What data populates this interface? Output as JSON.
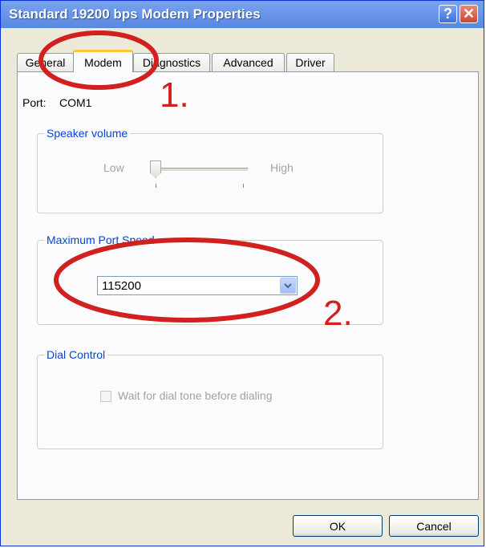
{
  "window": {
    "title": "Standard 19200 bps Modem Properties",
    "help_label": "?",
    "close_label": "✕"
  },
  "tabs": [
    {
      "label": "General",
      "active": false
    },
    {
      "label": "Modem",
      "active": true
    },
    {
      "label": "Diagnostics",
      "active": false
    },
    {
      "label": "Advanced",
      "active": false
    },
    {
      "label": "Driver",
      "active": false
    }
  ],
  "port": {
    "label": "Port:",
    "value": "COM1"
  },
  "speaker": {
    "group_title": "Speaker volume",
    "low_label": "Low",
    "high_label": "High",
    "level": 0
  },
  "max_speed": {
    "group_title": "Maximum Port Speed",
    "selected_value": "115200"
  },
  "dial_control": {
    "group_title": "Dial Control",
    "checkbox_label": "Wait for dial tone before dialing",
    "checked": false
  },
  "footer": {
    "ok_label": "OK",
    "cancel_label": "Cancel"
  },
  "annotations": {
    "step1_label": "1.",
    "step2_label": "2.",
    "color": "#d02020"
  }
}
